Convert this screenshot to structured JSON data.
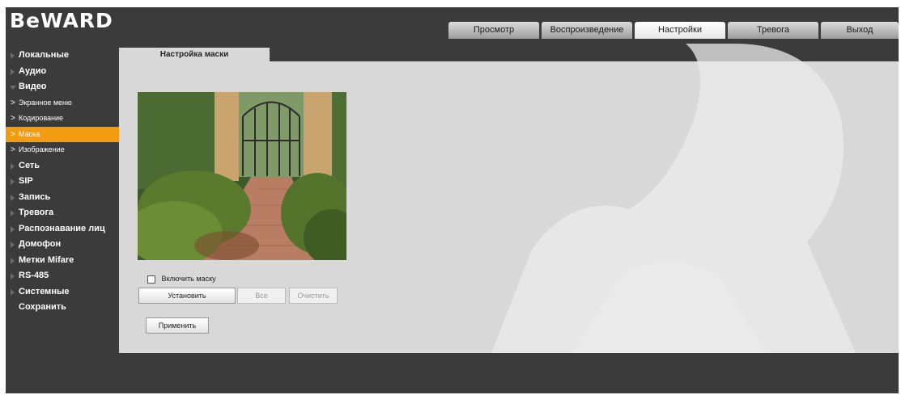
{
  "header": {
    "logo_text": "BeWARD",
    "tabs": [
      {
        "label": "Просмотр"
      },
      {
        "label": "Воспроизведение"
      },
      {
        "label": "Настройки"
      },
      {
        "label": "Тревога"
      },
      {
        "label": "Выход"
      }
    ],
    "active_tab": "Настройки"
  },
  "sidebar": {
    "items": [
      {
        "label": "Локальные"
      },
      {
        "label": "Аудио"
      },
      {
        "label": "Видео",
        "expanded": true,
        "children": [
          {
            "label": "Экранное меню"
          },
          {
            "label": "Кодирование"
          },
          {
            "label": "Маска",
            "active": true
          },
          {
            "label": "Изображение"
          }
        ]
      },
      {
        "label": "Сеть"
      },
      {
        "label": "SIP"
      },
      {
        "label": "Запись"
      },
      {
        "label": "Тревога"
      },
      {
        "label": "Распознавание лиц"
      },
      {
        "label": "Домофон"
      },
      {
        "label": "Метки Mifare"
      },
      {
        "label": "RS-485"
      },
      {
        "label": "Системные"
      },
      {
        "label": "Сохранить"
      }
    ]
  },
  "content": {
    "tab_title": "Настройка маски",
    "enable_mask_label": "Включить маску",
    "enable_mask_checked": false,
    "buttons": {
      "set": "Установить",
      "all": "Все",
      "clear": "Очистить",
      "apply": "Применить"
    }
  },
  "colors": {
    "frame_bg": "#3b3b3b",
    "content_bg": "#d8d8d8",
    "accent": "#f39c12"
  }
}
